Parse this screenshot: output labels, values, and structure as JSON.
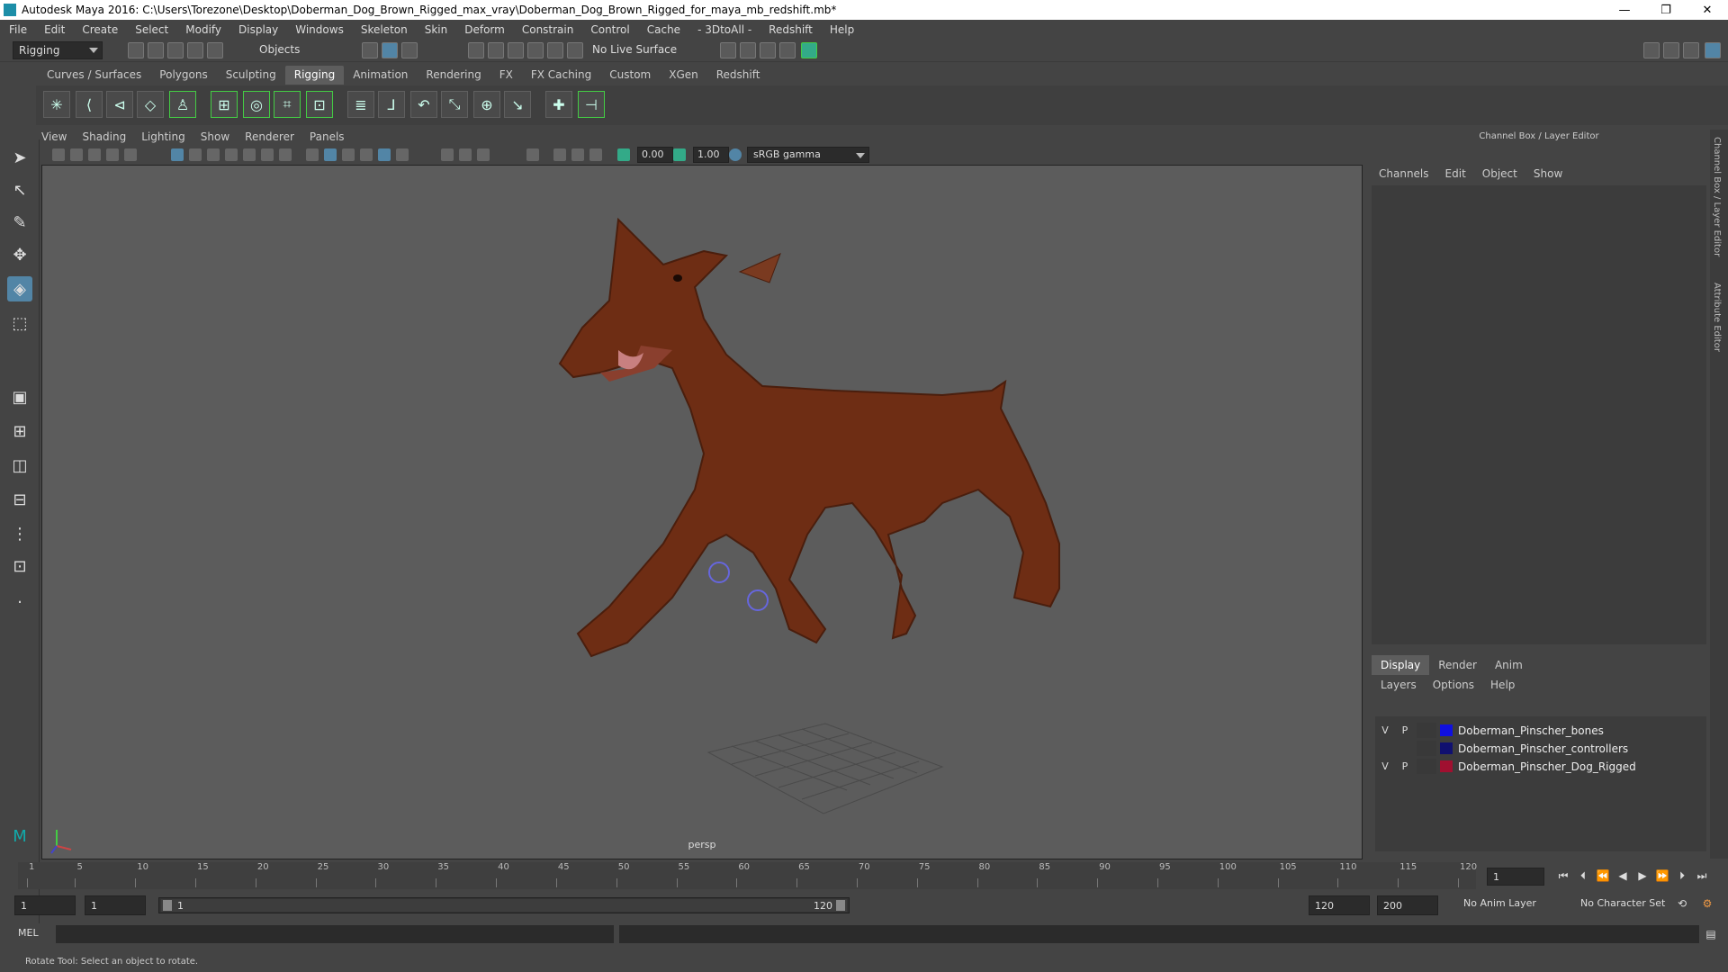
{
  "window": {
    "title": "Autodesk Maya 2016: C:\\Users\\Torezone\\Desktop\\Doberman_Dog_Brown_Rigged_max_vray\\Doberman_Dog_Brown_Rigged_for_maya_mb_redshift.mb*",
    "minimize": "—",
    "restore": "❐",
    "close": "✕"
  },
  "menubar": [
    "File",
    "Edit",
    "Create",
    "Select",
    "Modify",
    "Display",
    "Windows",
    "Skeleton",
    "Skin",
    "Deform",
    "Constrain",
    "Control",
    "Cache",
    "- 3DtoAll -",
    "Redshift",
    "Help"
  ],
  "statusline": {
    "mode": "Rigging",
    "selection_mode": "Objects",
    "live_surface": "No Live Surface"
  },
  "shelf_tabs": [
    {
      "label": "Curves / Surfaces",
      "active": false
    },
    {
      "label": "Polygons",
      "active": false
    },
    {
      "label": "Sculpting",
      "active": false
    },
    {
      "label": "Rigging",
      "active": true
    },
    {
      "label": "Animation",
      "active": false
    },
    {
      "label": "Rendering",
      "active": false
    },
    {
      "label": "FX",
      "active": false
    },
    {
      "label": "FX Caching",
      "active": false
    },
    {
      "label": "Custom",
      "active": false
    },
    {
      "label": "XGen",
      "active": false
    },
    {
      "label": "Redshift",
      "active": false
    }
  ],
  "panel_menu": [
    "View",
    "Shading",
    "Lighting",
    "Show",
    "Renderer",
    "Panels"
  ],
  "viewport_toolbar": {
    "exposure": "0.00",
    "gamma": "1.00",
    "color_space": "sRGB gamma"
  },
  "viewport": {
    "camera": "persp"
  },
  "channel_box": {
    "title": "Channel Box / Layer Editor",
    "menu": [
      "Channels",
      "Edit",
      "Object",
      "Show"
    ]
  },
  "layer_editor": {
    "tabs": [
      {
        "label": "Display",
        "active": true
      },
      {
        "label": "Render",
        "active": false
      },
      {
        "label": "Anim",
        "active": false
      }
    ],
    "menu": [
      "Layers",
      "Options",
      "Help"
    ],
    "layers": [
      {
        "v": "V",
        "p": "P",
        "color": "#1010e0",
        "name": "Doberman_Pinscher_bones"
      },
      {
        "v": "",
        "p": "",
        "color": "#101070",
        "name": "Doberman_Pinscher_controllers"
      },
      {
        "v": "V",
        "p": "P",
        "color": "#a01030",
        "name": "Doberman_Pinscher_Dog_Rigged"
      }
    ]
  },
  "side_tabs": [
    "Channel Box / Layer Editor",
    "Attribute Editor"
  ],
  "timeline": {
    "ticks": [
      "1",
      "5",
      "10",
      "15",
      "20",
      "25",
      "30",
      "35",
      "40",
      "45",
      "50",
      "55",
      "60",
      "65",
      "70",
      "75",
      "80",
      "85",
      "90",
      "95",
      "100",
      "105",
      "110",
      "115",
      "120"
    ],
    "current_frame": "1"
  },
  "range": {
    "start": "1",
    "playback_start": "1",
    "slider_start": "1",
    "slider_end": "120",
    "playback_end": "120",
    "end": "200",
    "anim_layer": "No Anim Layer",
    "character_set": "No Character Set"
  },
  "command_line": {
    "label": "MEL"
  },
  "help_line": "Rotate Tool: Select an object to rotate.",
  "colors": {
    "accent": "#5285a6",
    "background": "#444444",
    "viewport": "#5c5c5c"
  }
}
